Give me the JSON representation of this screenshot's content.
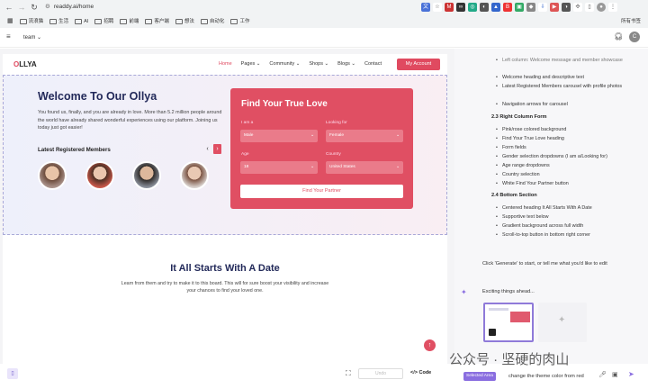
{
  "browser": {
    "url": "readdy.ai/home",
    "bookmarks": [
      "流浪猫",
      "生活",
      "AI",
      "招聘",
      "前端",
      "客户端",
      "想法",
      "自动化",
      "工作"
    ],
    "bookmarks_right": "所有书签"
  },
  "app": {
    "project_label": "team"
  },
  "site": {
    "logo_prefix": "O",
    "logo_rest": "LLYA",
    "nav": [
      "Home",
      "Pages",
      "Community",
      "Shops",
      "Blogs",
      "Contact"
    ],
    "account_button": "My Account",
    "hero": {
      "title": "Welcome To Our Ollya",
      "text": "You found us, finally, and you are already in love. More than 5.2 million people around the world have already shared wonderful experiences using our platform. Joining us today just got easier!",
      "members_heading": "Latest Registered Members"
    },
    "form": {
      "title": "Find Your True Love",
      "iam_label": "I am a",
      "iam_value": "Male",
      "looking_label": "Looking for",
      "looking_value": "Female",
      "age_label": "Age",
      "age_value": "18",
      "country_label": "Country",
      "country_value": "United States",
      "button": "Find Your Partner"
    },
    "section2": {
      "title": "It All Starts With A Date",
      "text": "Learn from them and try to make it to this board. This will for sure boost your visibility and increase your chances to find your loved one."
    }
  },
  "editor": {
    "device_placeholder": "Undo",
    "code_label": "Code"
  },
  "panel": {
    "top_items": [
      "Left column: Welcome message and member showcase",
      "Welcome heading and descriptive text",
      "Latest Registered Members carousel with profile photos",
      "Navigation arrows for carousel"
    ],
    "section_23": "2.3 Right Column Form",
    "items_23": [
      "Pink/rose colored background",
      "Find Your True Love heading",
      "Form fields",
      "Gender selection dropdowns (I am a/Looking for)",
      "Age range dropdowns",
      "Country selection",
      "White Find Your Partner button"
    ],
    "section_24": "2.4 Bottom Section",
    "items_24": [
      "Centered heading It All Starts With A Date",
      "Supportive text below",
      "Gradient background across full width",
      "Scroll-to-top button in bottom right corner"
    ],
    "generate_hint": "Click 'Generate' to start, or tell me what you'd like to edit",
    "status": "Exciting things ahead...",
    "chip": "Selected Area",
    "input_value": "change the theme color from red"
  },
  "watermark": "公众号 · 坚硬的肉山"
}
